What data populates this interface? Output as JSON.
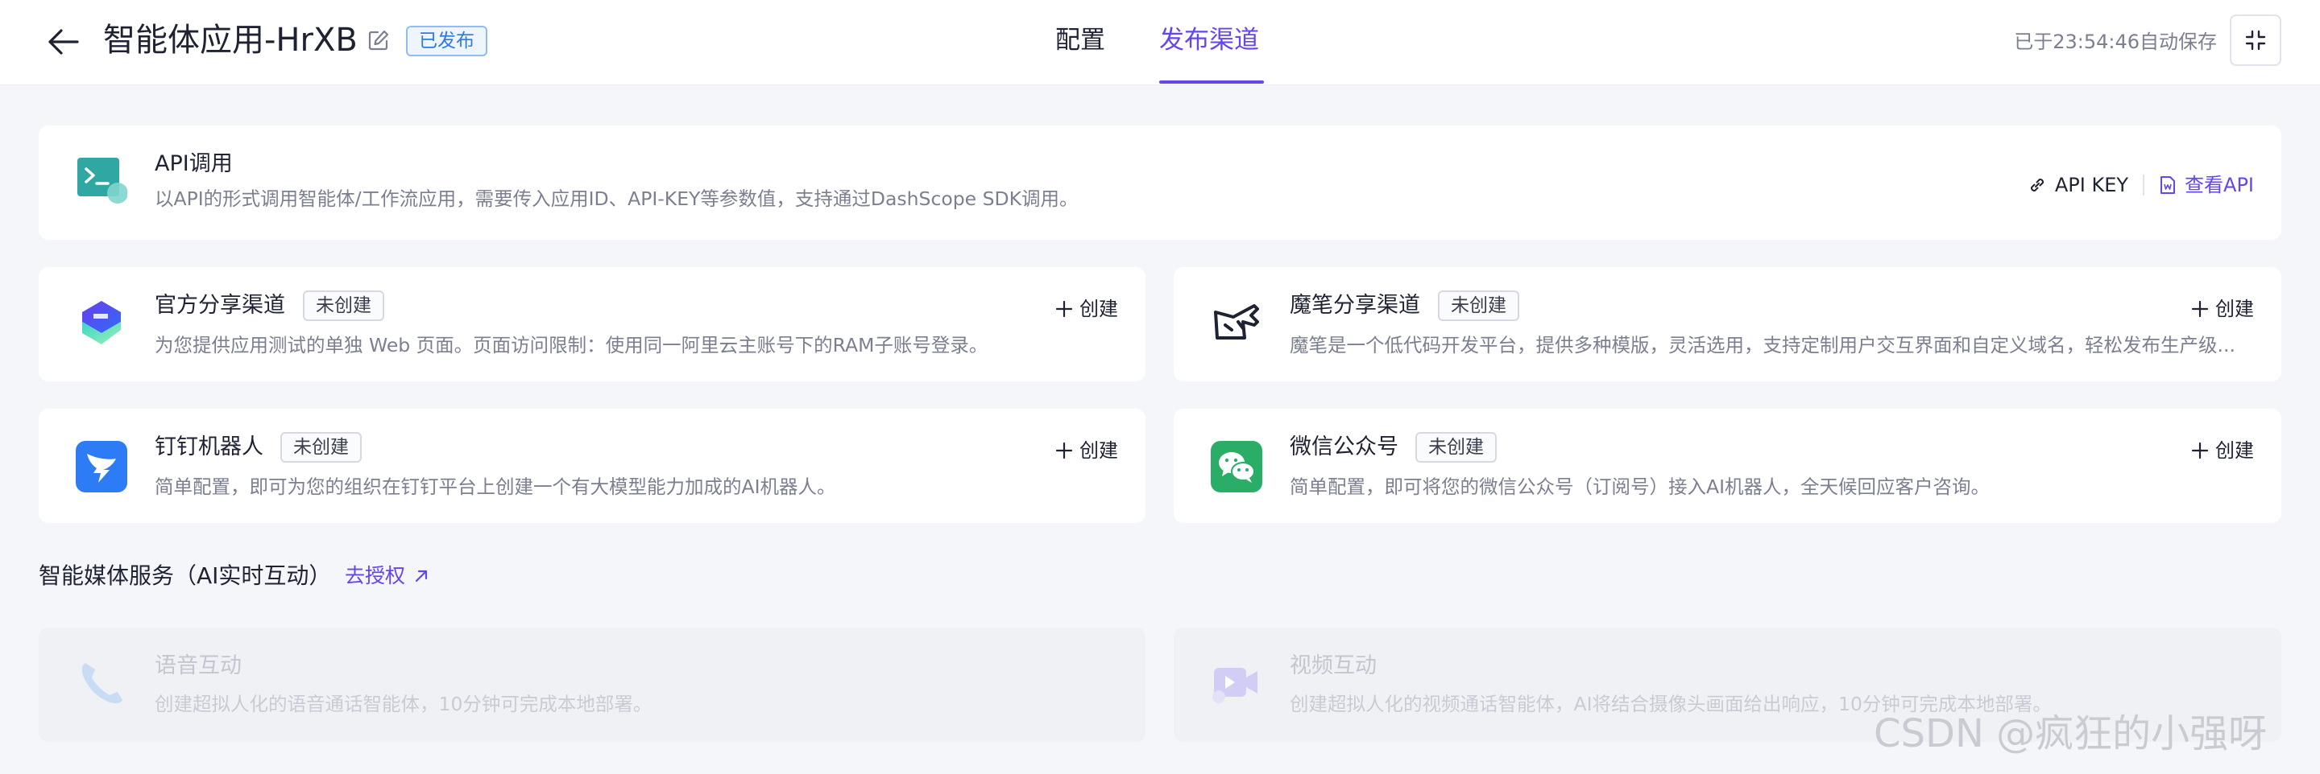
{
  "header": {
    "title": "智能体应用-HrXB",
    "status_badge": "已发布",
    "tabs": [
      {
        "label": "配置",
        "active": false
      },
      {
        "label": "发布渠道",
        "active": true
      }
    ],
    "autosave_text": "已于23:54:46自动保存"
  },
  "api_card": {
    "title": "API调用",
    "description": "以API的形式调用智能体/工作流应用，需要传入应用ID、API-KEY等参数值，支持通过DashScope SDK调用。",
    "api_key_label": "API KEY",
    "view_api_label": "查看API"
  },
  "channels": [
    {
      "title": "官方分享渠道",
      "status": "未创建",
      "description": "为您提供应用测试的单独 Web 页面。页面访问限制：使用同一阿里云主账号下的RAM子账号登录。",
      "action": "创建",
      "icon": "official-share-icon"
    },
    {
      "title": "魔笔分享渠道",
      "status": "未创建",
      "description": "魔笔是一个低代码开发平台，提供多种模版，灵活选用，支持定制用户交互界面和自定义域名，轻松发布生产级...",
      "action": "创建",
      "icon": "mobi-icon"
    },
    {
      "title": "钉钉机器人",
      "status": "未创建",
      "description": "简单配置，即可为您的组织在钉钉平台上创建一个有大模型能力加成的AI机器人。",
      "action": "创建",
      "icon": "dingtalk-icon"
    },
    {
      "title": "微信公众号",
      "status": "未创建",
      "description": "简单配置，即可将您的微信公众号（订阅号）接入AI机器人，全天候回应客户咨询。",
      "action": "创建",
      "icon": "wechat-icon"
    }
  ],
  "media_section": {
    "title": "智能媒体服务（AI实时互动）",
    "auth_link": "去授权",
    "items": [
      {
        "title": "语音互动",
        "description": "创建超拟人化的语音通话智能体，10分钟可完成本地部署。",
        "icon": "phone-icon"
      },
      {
        "title": "视频互动",
        "description": "创建超拟人化的视频通话智能体，AI将结合摄像头画面给出响应，10分钟可完成本地部署。",
        "icon": "video-icon"
      }
    ]
  },
  "watermark": "CSDN @疯狂的小强呀",
  "colors": {
    "accent": "#6445ee",
    "badge_blue": "#2b7ae8",
    "background": "#f5f6f9"
  }
}
